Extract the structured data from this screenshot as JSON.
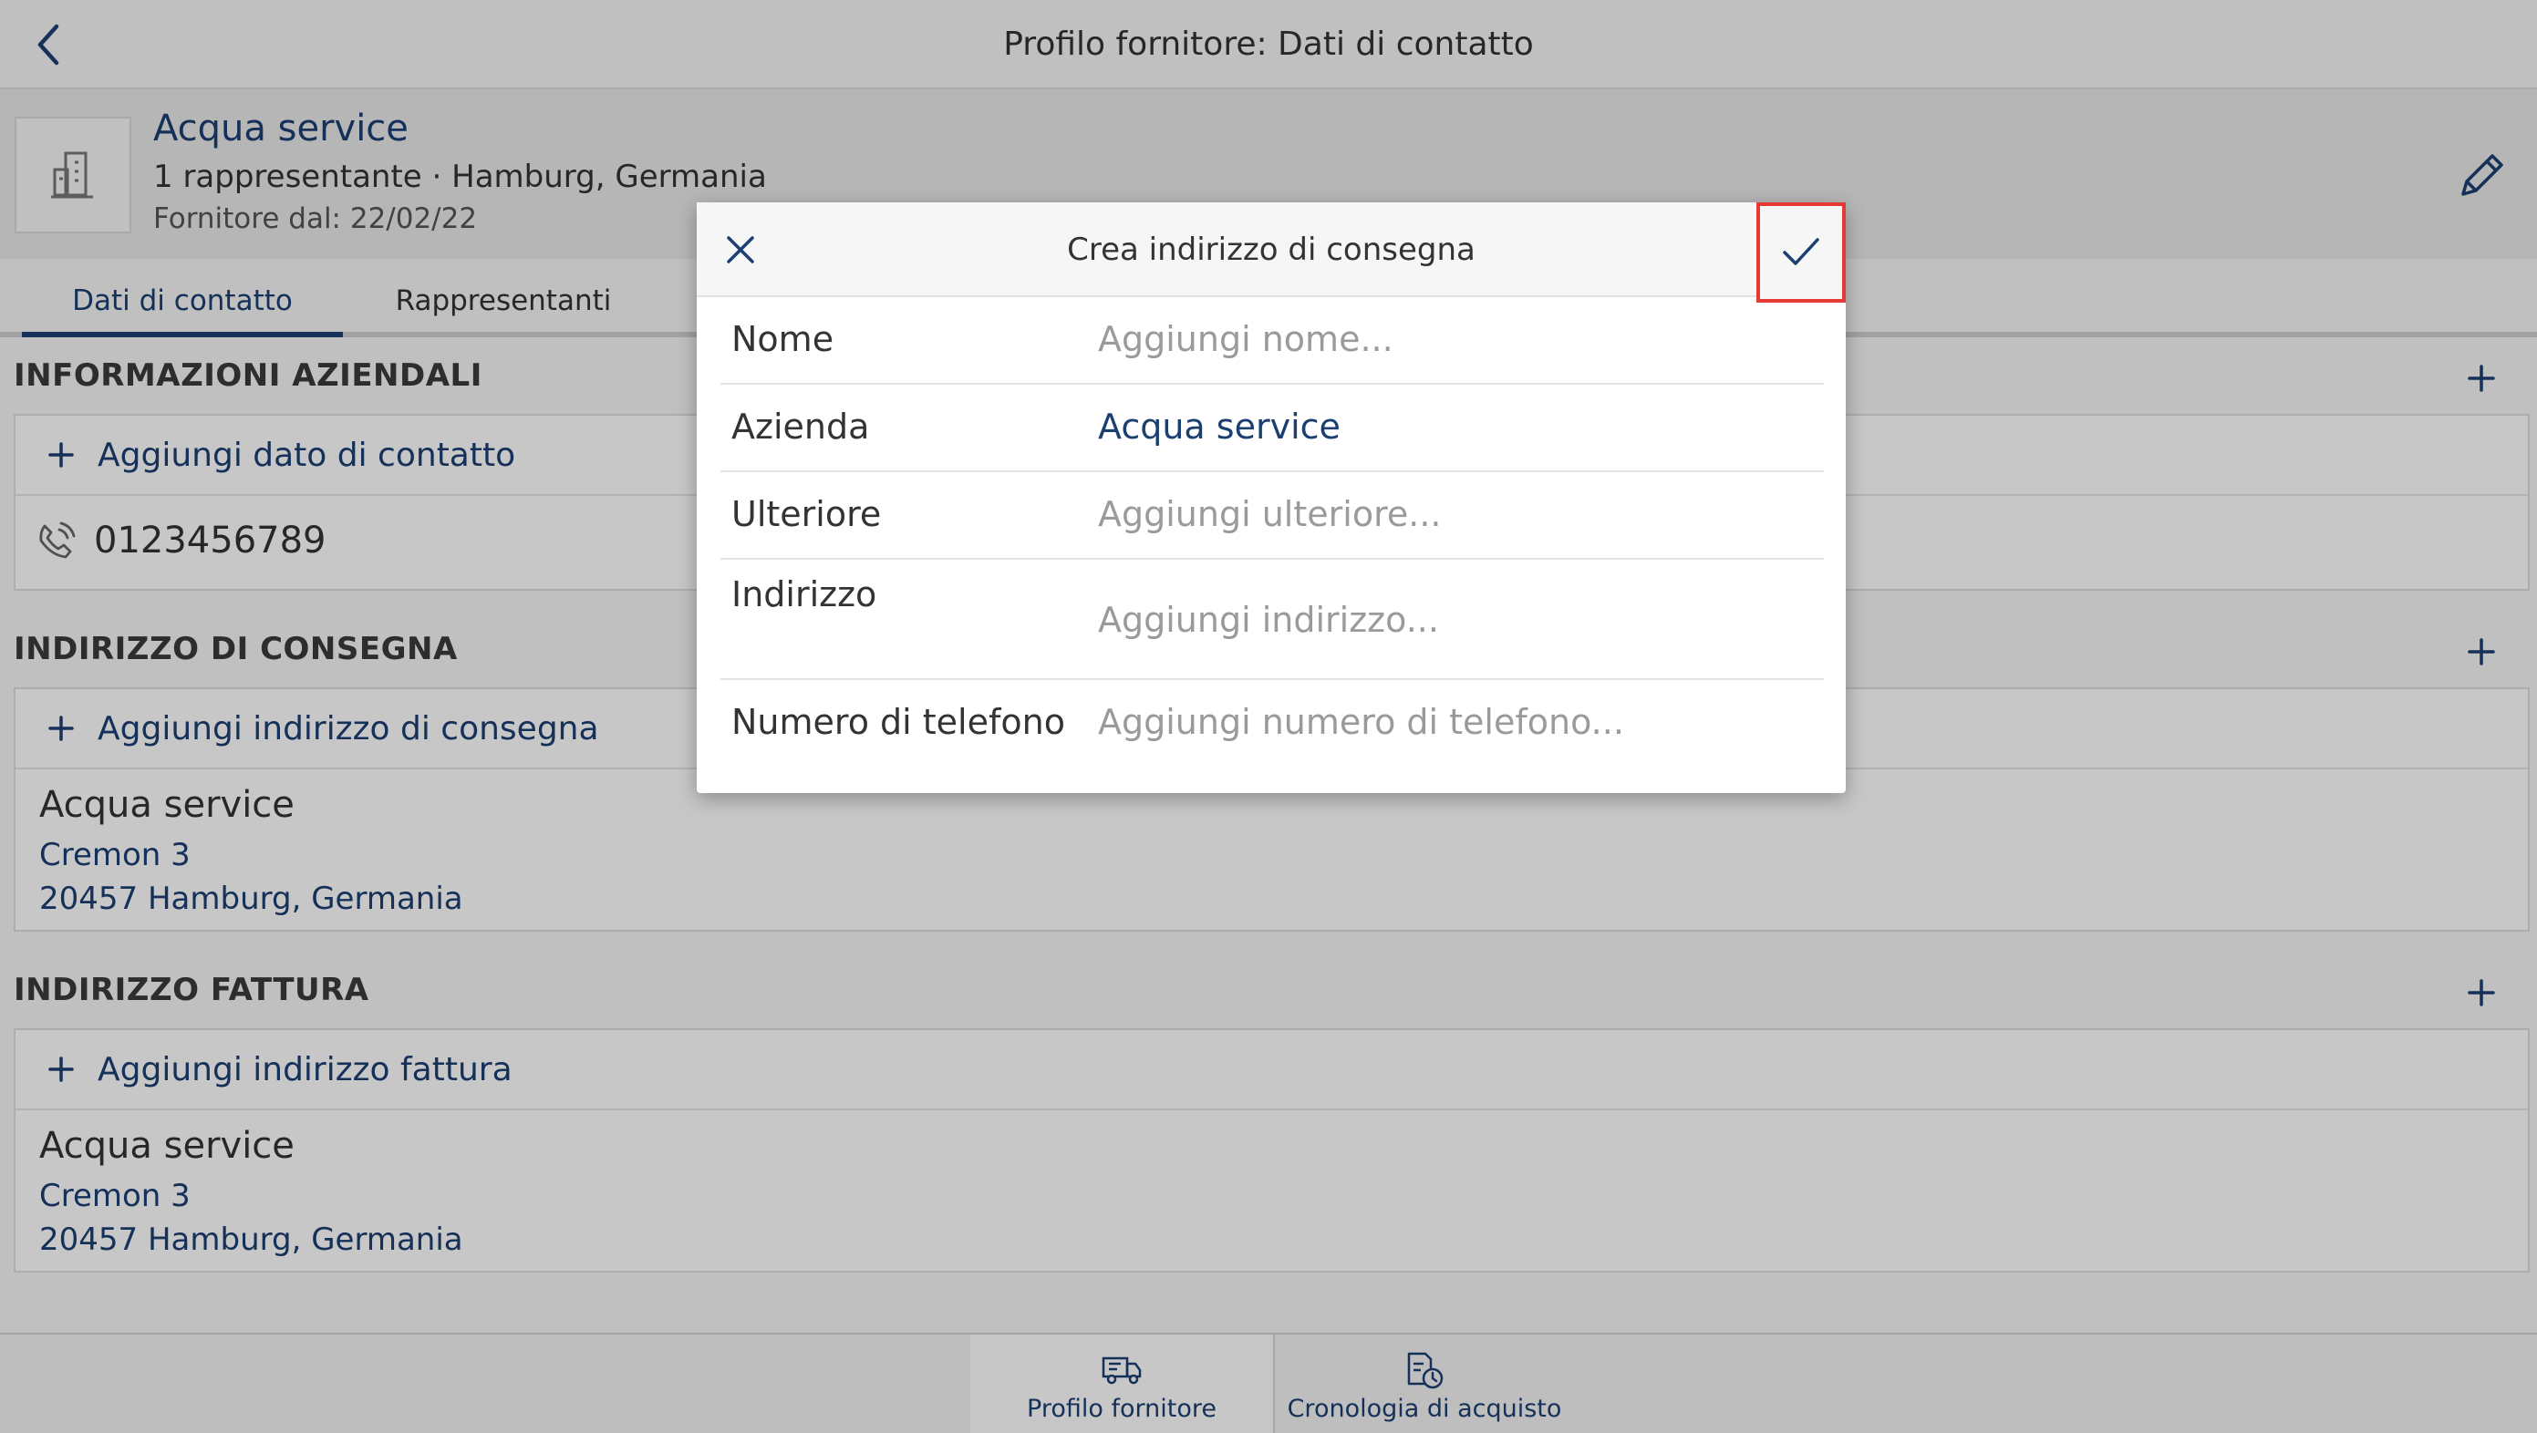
{
  "topbar": {
    "title": "Profilo fornitore: Dati di contatto"
  },
  "supplier": {
    "name": "Acqua service",
    "subtitle": "1 rappresentante · Hamburg, Germania",
    "since": "Fornitore dal: 22/02/22"
  },
  "tabs": [
    {
      "label": "Dati di contatto",
      "active": true
    },
    {
      "label": "Rappresentanti",
      "active": false
    }
  ],
  "sections": {
    "company_info": {
      "title": "INFORMAZIONI AZIENDALI",
      "add_label": "Aggiungi dato di contatto",
      "phone": "0123456789"
    },
    "delivery": {
      "title": "INDIRIZZO DI CONSEGNA",
      "add_label": "Aggiungi indirizzo di consegna",
      "name": "Acqua service",
      "street": "Cremon 3",
      "city": "20457 Hamburg, Germania"
    },
    "invoice": {
      "title": "INDIRIZZO FATTURA",
      "add_label": "Aggiungi indirizzo fattura",
      "name": "Acqua service",
      "street": "Cremon 3",
      "city": "20457 Hamburg, Germania"
    }
  },
  "bottom_nav": [
    {
      "label": "Profilo fornitore",
      "active": true
    },
    {
      "label": "Cronologia di acquisto",
      "active": false
    }
  ],
  "dialog": {
    "title": "Crea indirizzo di consegna",
    "fields": [
      {
        "label": "Nome",
        "placeholder": "Aggiungi nome...",
        "value": ""
      },
      {
        "label": "Azienda",
        "placeholder": "",
        "value": "Acqua service"
      },
      {
        "label": "Ulteriore",
        "placeholder": "Aggiungi ulteriore...",
        "value": ""
      },
      {
        "label": "Indirizzo",
        "placeholder": "Aggiungi indirizzo...",
        "value": ""
      },
      {
        "label": "Numero di telefono",
        "placeholder": "Aggiungi numero di telefono...",
        "value": ""
      }
    ]
  },
  "colors": {
    "accent": "#1c3f72",
    "highlight": "#e53935"
  },
  "icons": [
    "back-arrow-icon",
    "building-icon",
    "pencil-icon",
    "plus-icon",
    "phone-icon",
    "close-icon",
    "checkmark-icon",
    "truck-icon",
    "history-icon"
  ]
}
